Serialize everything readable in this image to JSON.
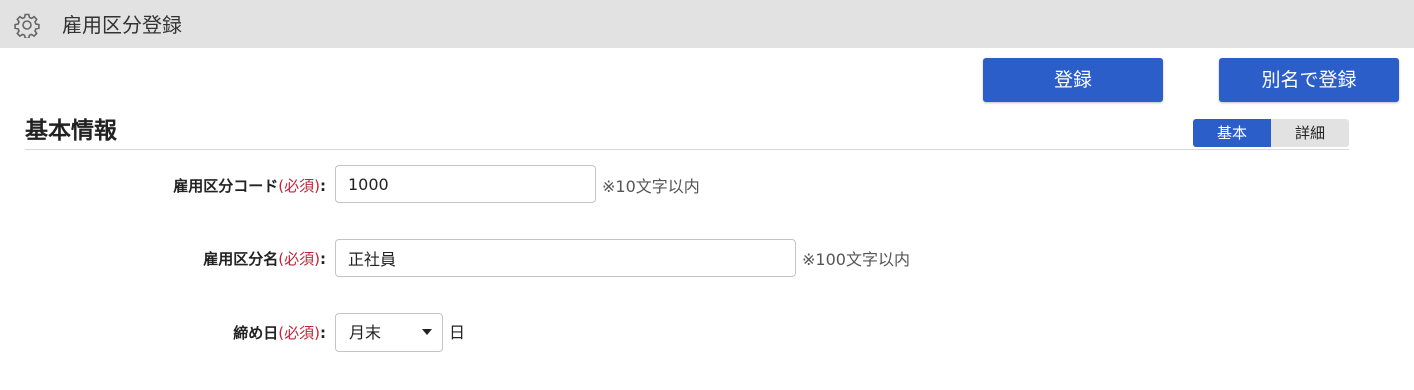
{
  "header": {
    "title": "雇用区分登録",
    "icon": "gear-icon"
  },
  "toolbar": {
    "register_label": "登録",
    "register_alias_label": "別名で登録"
  },
  "section": {
    "title": "基本情報",
    "tabs": [
      {
        "label": "基本",
        "active": true
      },
      {
        "label": "詳細",
        "active": false
      }
    ]
  },
  "form": {
    "code": {
      "label": "雇用区分コード",
      "required": "(必須)",
      "colon": ":",
      "value": "1000",
      "hint": "※10文字以内"
    },
    "name": {
      "label": "雇用区分名",
      "required": "(必須)",
      "colon": ":",
      "value": "正社員",
      "hint": "※100文字以内"
    },
    "closing_day": {
      "label": "締め日",
      "required": "(必須)",
      "colon": ":",
      "selected": "月末",
      "unit": "日"
    }
  },
  "colors": {
    "primary": "#2c5ec9",
    "header_bg": "#e2e2e2",
    "required": "#c0253a"
  }
}
